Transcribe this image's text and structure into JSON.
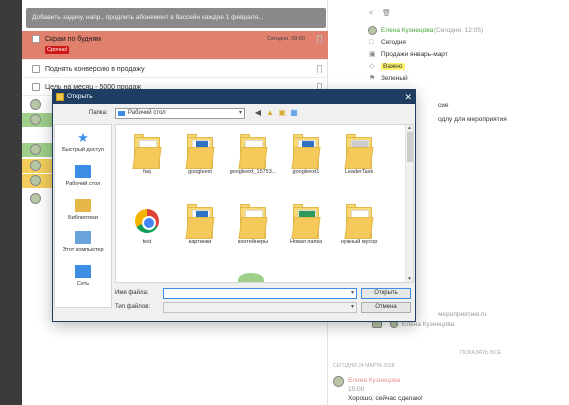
{
  "task_input": {
    "placeholder": "Добавить задачу, напр., продлить абонемент в бассейн каждое 1 февраля..."
  },
  "tasks": [
    {
      "label": "Скрам по будням",
      "badge": "Срочно!",
      "date": "Сегодня, 09:00"
    },
    {
      "label": "Поднять конверсию в продажу"
    },
    {
      "label": "Цель на месяц - 5000 продаж"
    }
  ],
  "details": {
    "author": "Елена Кузнецова",
    "author_meta": "(Сегодня, 12:05)",
    "lines": [
      "Сегодня",
      "Продажи январь-март",
      "Важно",
      "Зеленый"
    ],
    "partial_1": "сие",
    "partial_2": "одлу для мероприятия",
    "attachment": "мероприятию.ru",
    "attachment_author": "Елена Кузнецова",
    "show_all": "ПОКАЗАТЬ ВСЕ",
    "comment_date": "СЕГОДНЯ 24 МАРТА 2018",
    "comment_author": "Елена Кузнецова",
    "comment_time": "15:00",
    "comment_text": "Хорошо, сейчас сделаю!"
  },
  "dialog": {
    "title": "Открыть",
    "folder_label": "Папка:",
    "folder_value": "Рабочий стол",
    "places": [
      "Быстрый доступ",
      "Рабочий стол",
      "Библиотеки",
      "Этот компьютер",
      "Сеть"
    ],
    "files_row1": [
      "faq",
      "googleext",
      "googleext_15753...",
      "googleext1",
      "LeaderTask"
    ],
    "files_row2": [
      "test",
      "картинки",
      "контейнеры",
      "Новая папка",
      "нужный мусор"
    ],
    "file_name_label": "Имя файла:",
    "file_type_label": "Тип файлов:",
    "open_button": "Открыть",
    "cancel_button": "Отмена"
  },
  "colors": {
    "urgent_bg": "#e0806d",
    "badge_red": "#d01818",
    "dialog_title": "#1e3d60",
    "accent_blue": "#3c8ee4",
    "folder_yellow": "#f8d775"
  }
}
